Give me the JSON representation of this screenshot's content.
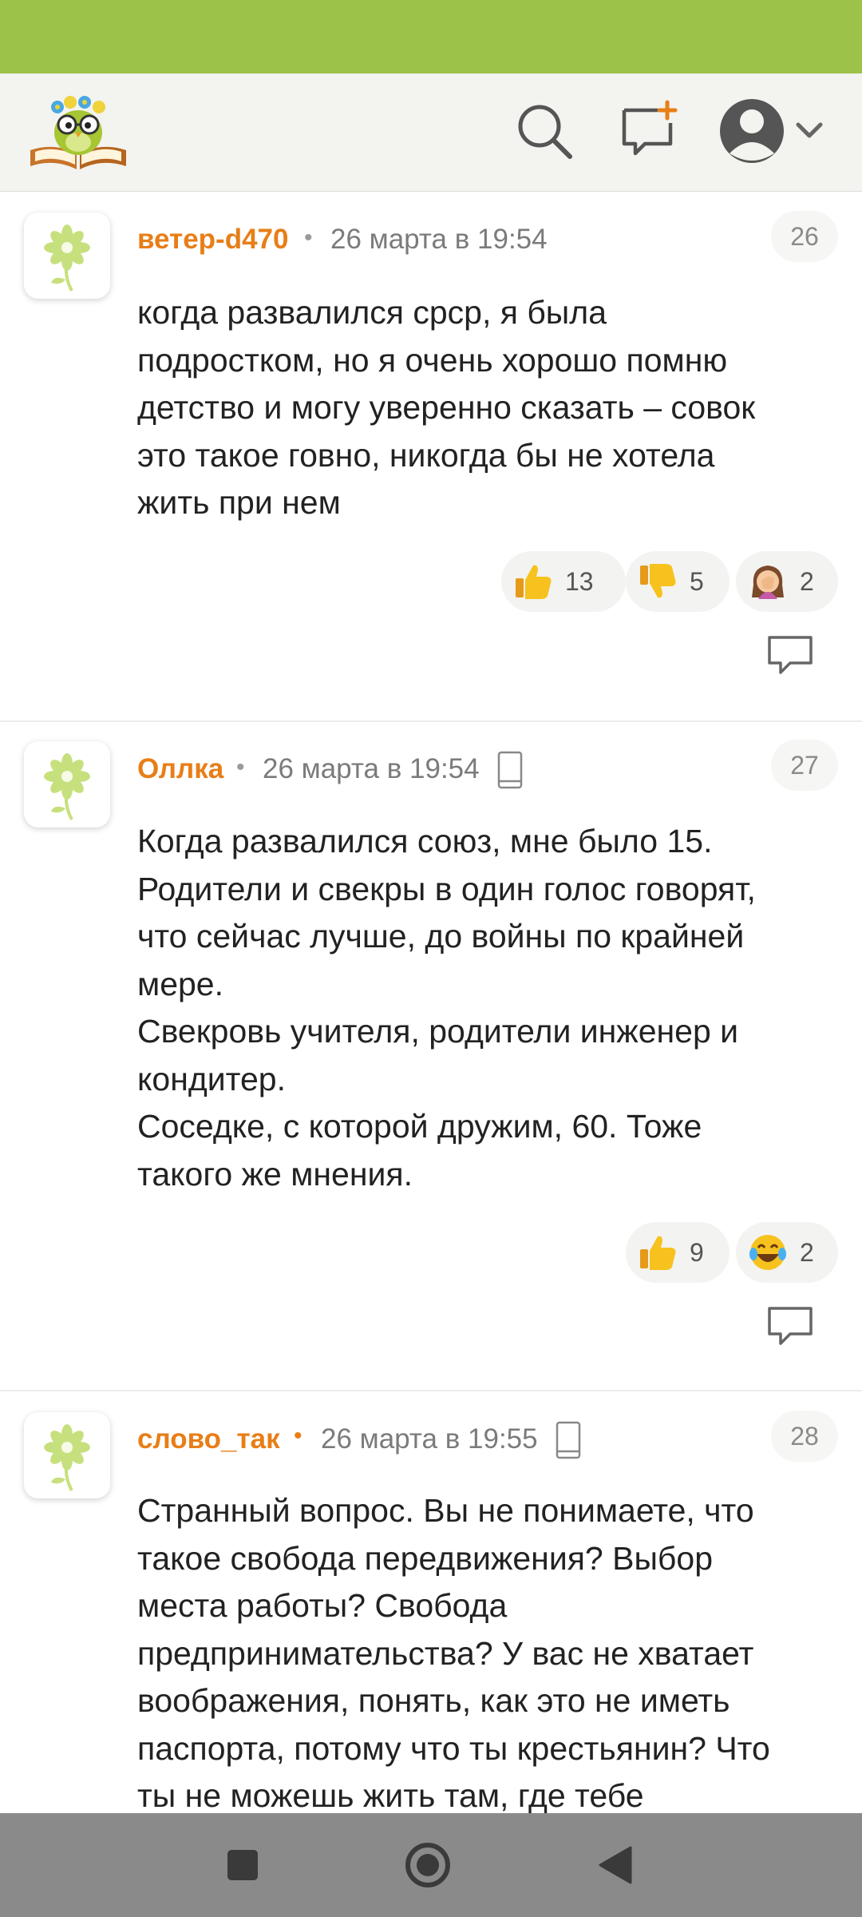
{
  "colors": {
    "status_bar": "#9dc24a",
    "header_bg": "#f3f3ef",
    "author": "#e87e17",
    "nav_bar": "#8a8a8a"
  },
  "header": {
    "logo_icon": "owl-on-book-logo",
    "icons": [
      "search-icon",
      "new-post-icon",
      "user-avatar-icon",
      "chevron-down-icon"
    ]
  },
  "comments": [
    {
      "author": "ветер-d470",
      "date": "26 марта в 19:54",
      "number": "26",
      "device_icon": "",
      "text": "когда развалился срср, я была\nподростком, но я очень хорошо помню\nдетство и могу уверенно сказать – совок\nэто такое говно, никогда бы не хотела\nжить при нем",
      "reactions": [
        {
          "emoji": "thumbs-up",
          "count": "13"
        },
        {
          "emoji": "thumbs-down",
          "count": "5"
        },
        {
          "emoji": "facepalm",
          "count": "2"
        }
      ]
    },
    {
      "author": "Оллка",
      "date": "26 марта в 19:54",
      "number": "27",
      "device_icon": "phone-icon",
      "text": "Когда развалился союз, мне было 15.\nРодители и свекры в один голос говорят,\nчто сейчас лучше, до войны по крайней\nмере.\nСвекровь учителя, родители инженер и\nкондитер.\nСоседке, с которой дружим, 60. Тоже\nтакого же мнения.",
      "reactions": [
        {
          "emoji": "thumbs-up",
          "count": "9"
        },
        {
          "emoji": "laughing-tears",
          "count": "2"
        }
      ]
    },
    {
      "author": "слово_так",
      "date": "26 марта в 19:55",
      "number": "28",
      "device_icon": "phone-icon",
      "text": "Странный вопрос. Вы не понимаете, что\nтакое свобода передвижения? Выбор\nместа работы? Свобода\nпредпринимательства? У вас не хватает\nвоображения, понять, как это не иметь\nпаспорта, потому что ты крестьянин? Что\nты не можешь жить там, где тебе",
      "reactions": []
    }
  ],
  "nav": [
    "recents-square-icon",
    "home-circle-icon",
    "back-triangle-icon"
  ]
}
